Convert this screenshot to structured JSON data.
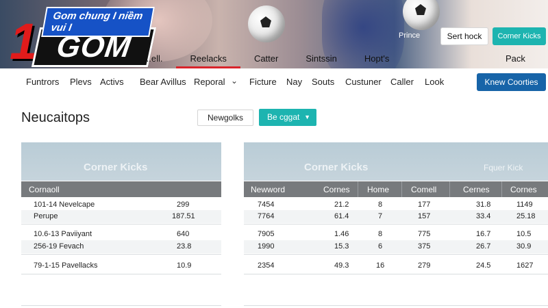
{
  "hero": {
    "logo_tagline": "Gom chung I niềm vui I",
    "logo_numeral": "1",
    "logo_wordmark": "GOM",
    "label": "Prince",
    "nav": [
      {
        "label": "...ell."
      },
      {
        "label": "Reelacks"
      },
      {
        "label": "Catter"
      },
      {
        "label": "Sintssin"
      },
      {
        "label": "Hopt's"
      }
    ],
    "pack_label": "Pack",
    "btn_secondary": "Sert hock",
    "btn_primary": "Corner Kicks"
  },
  "mainnav": {
    "items": [
      "Funtrors",
      "Plevs",
      "Activs",
      "Bear Avillus",
      "Reporal",
      "Ficture",
      "Nay",
      "Souts",
      "Custuner",
      "Caller",
      "Look"
    ],
    "cta": "Knew Coorties"
  },
  "page": {
    "title": "Neucaitops",
    "select_label": "Newgolks",
    "dropdown_label": "Be cggat"
  },
  "left_table": {
    "title": "Corner Kicks",
    "header": "Cornaoll",
    "rows": [
      {
        "name": "101-14 Nevelcape",
        "value": "299"
      },
      {
        "name": "Perupe",
        "value": "187.51"
      },
      {
        "name": "10.6-13 Paviiyant",
        "value": "640"
      },
      {
        "name": "256-19 Fevach",
        "value": "23.8"
      },
      {
        "name": "79-1-15 Pavellacks",
        "value": "10.9"
      }
    ]
  },
  "right_table": {
    "title": "Corner Kicks",
    "side_label": "Fquer Kick",
    "headers": [
      "Newword",
      "Cornes",
      "Home",
      "Comell",
      "Cernes",
      "Cornes"
    ],
    "rows": [
      [
        "7454",
        "21.2",
        "8",
        "177",
        "31.8",
        "1149"
      ],
      [
        "7764",
        "61.4",
        "7",
        "157",
        "33.4",
        "25.18"
      ],
      [
        "7905",
        "1.46",
        "8",
        "775",
        "16.7",
        "10.5"
      ],
      [
        "1990",
        "15.3",
        "6",
        "375",
        "26.7",
        "30.9"
      ],
      [
        "2354",
        "49.3",
        "16",
        "279",
        "24.5",
        "1627"
      ]
    ]
  },
  "colors": {
    "accent_teal": "#1db4b0",
    "primary_blue": "#1764a8",
    "active_tab_red": "#d9232a",
    "table_header": "#777a7d"
  }
}
